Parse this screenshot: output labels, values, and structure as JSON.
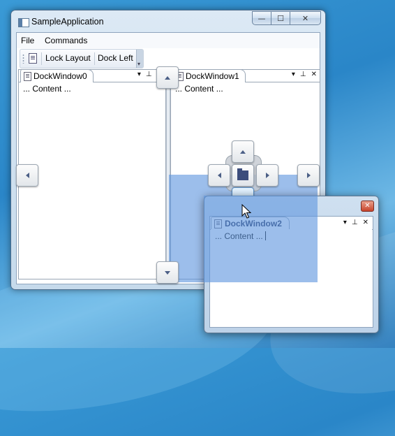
{
  "window": {
    "title": "SampleApplication",
    "min_glyph": "—",
    "max_glyph": "☐",
    "close_glyph": "✕"
  },
  "menu": {
    "items": [
      "File",
      "Commands"
    ]
  },
  "toolbar": {
    "icon": "document-icon",
    "lock_label": "Lock Layout",
    "dock_label": "Dock Left"
  },
  "panes": [
    {
      "title": "DockWindow0",
      "content": "... Content ...",
      "buttons": [
        "▾",
        "⊥",
        "✕"
      ]
    },
    {
      "title": "DockWindow1",
      "content": "... Content ...",
      "buttons": [
        "▾",
        "⊥",
        "✕"
      ]
    }
  ],
  "floating": {
    "title": "DockWindow2",
    "content": "... Content ...",
    "close_glyph": "✕",
    "buttons": [
      "▾",
      "⊥",
      "✕"
    ]
  },
  "guides": [
    "dock-top",
    "dock-left",
    "dock-bottom",
    "dock-right",
    "dock-center",
    "center-top",
    "center-left",
    "center-right",
    "center-bottom"
  ],
  "colors": {
    "drop_preview": "#6096de",
    "guide_arrow": "#4b5f86",
    "close_red": "#c7432b"
  }
}
